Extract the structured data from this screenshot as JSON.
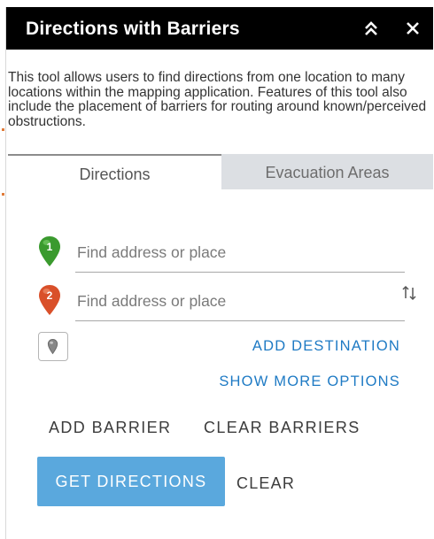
{
  "window": {
    "title": "Directions with Barriers",
    "collapse_icon": "double-chevron-up-icon",
    "close_icon": "close-icon"
  },
  "description": "This tool allows users to find directions from one location to many locations within the mapping application. Features of this tool also include the placement of barriers for routing around known/perceived obstructions.",
  "tabs": [
    {
      "label": "Directions",
      "active": true
    },
    {
      "label": "Evacuation Areas",
      "active": false
    }
  ],
  "stops": [
    {
      "number": "1",
      "placeholder": "Find address or place",
      "value": "",
      "color": "#3a9a2e"
    },
    {
      "number": "2",
      "placeholder": "Find address or place",
      "value": "",
      "color": "#d9502a"
    }
  ],
  "links": {
    "add_destination": "ADD DESTINATION",
    "show_more_options": "SHOW MORE OPTIONS"
  },
  "barriers": {
    "add": "ADD BARRIER",
    "clear": "CLEAR BARRIERS"
  },
  "buttons": {
    "get_directions": "GET DIRECTIONS",
    "clear": "CLEAR"
  },
  "colors": {
    "titlebar": "#000000",
    "accent_link": "#1e7ac4",
    "primary_button": "#5aa8dd",
    "inactive_tab": "#dcdfe3"
  }
}
